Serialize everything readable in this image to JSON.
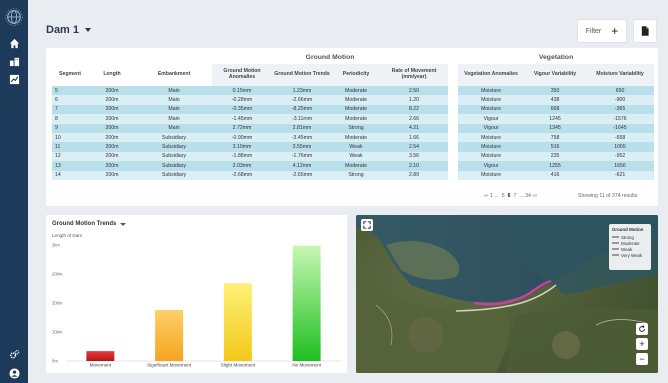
{
  "page": {
    "title": "Dam 1"
  },
  "toolbar": {
    "filter_label": "Filter",
    "plus": "+"
  },
  "table": {
    "group_headers": [
      "Ground Motion",
      "Vegetation"
    ],
    "columns": [
      "Segment",
      "Length",
      "Embankment",
      "Ground Motion Anomalies",
      "Ground Motion Trends",
      "Periodicity",
      "Rate of Movement (mm/year)",
      "Vegetation Anomalies",
      "Vigour Variability",
      "Moisture Variability"
    ],
    "rows": [
      [
        "5",
        "200m",
        "Main",
        "0.15mm",
        "1.23mm",
        "Moderate",
        "2.50",
        "Moisture",
        "350",
        "650"
      ],
      [
        "6",
        "200m",
        "Main",
        "-0.28mm",
        "-2.66mm",
        "Moderate",
        "1.20",
        "Moisture",
        "438",
        "-900"
      ],
      [
        "7",
        "200m",
        "Main",
        "-0.35mm",
        "-8.25mm",
        "Moderate",
        "8.22",
        "Moisture",
        "668",
        "-365"
      ],
      [
        "8",
        "200m",
        "Main",
        "-1.45mm",
        "-3.11mm",
        "Moderate",
        "2.66",
        "Vigour",
        "1245",
        "-1576"
      ],
      [
        "9",
        "200m",
        "Main",
        "2.72mm",
        "2.81mm",
        "Strong",
        "4.21",
        "Vigour",
        "1345",
        "-1645"
      ],
      [
        "10",
        "200m",
        "Subsidiary",
        "-0.90mm",
        "-3.45mm",
        "Moderate",
        "1.66",
        "Moisture",
        "758",
        "-658"
      ],
      [
        "11",
        "200m",
        "Subsidiary",
        "3.10mm",
        "3.55mm",
        "Weak",
        "2.54",
        "Moisture",
        "516",
        "1065"
      ],
      [
        "12",
        "200m",
        "Subsidiary",
        "-1.88mm",
        "-1.76mm",
        "Weak",
        "3.56",
        "Moisture",
        "235",
        "-952"
      ],
      [
        "13",
        "200m",
        "Subsidiary",
        "2.03mm",
        "4.12mm",
        "Moderate",
        "2.10",
        "Vigour",
        "1255",
        "1656"
      ],
      [
        "14",
        "200m",
        "Subsidiary",
        "-2.68mm",
        "-2.65mm",
        "Strong",
        "2.89",
        "Moisture",
        "416",
        "-621"
      ]
    ]
  },
  "pagination": {
    "arrows_left": "«‹ 1 ...",
    "pages": [
      "5",
      "6",
      "7"
    ],
    "current": "6",
    "arrows_right": "... 34 ›»",
    "results": "Showing 11 of 374 results"
  },
  "chart_data": {
    "type": "bar",
    "title": "Ground Motion Trends",
    "ylabel": "Length of Dam",
    "yticks": [
      "2km",
      "200m",
      "200m",
      "100m",
      "0m"
    ],
    "ytick_values": [
      200,
      150,
      100,
      50,
      0
    ],
    "categories": [
      "Movement",
      "Significant Movement",
      "Slight Movement",
      "No Movement"
    ],
    "values": [
      17,
      88,
      134,
      199
    ],
    "ylim": [
      0,
      200
    ],
    "colors": [
      [
        "#e83a3a",
        "#b51616"
      ],
      [
        "#ffcf6a",
        "#f5a51f"
      ],
      [
        "#fff176",
        "#f2c71a"
      ],
      [
        "#c8f7b4",
        "#1fbf1f"
      ]
    ],
    "grid": false
  },
  "map": {
    "legend_title": "Ground Motion",
    "legend_items": [
      {
        "label": "Strong",
        "color": "#d63ab0"
      },
      {
        "label": "Moderate",
        "color": "#e986cc"
      },
      {
        "label": "Weak",
        "color": "#f3c2e6"
      },
      {
        "label": "Very Weak",
        "color": "#ffffff"
      }
    ],
    "zoom_in": "+",
    "zoom_out": "−"
  },
  "colors": {
    "sidebar": "#1e3a5a",
    "row_odd": "#b9dfea",
    "row_even": "#d9eff5",
    "dam_line": "#d63ab0"
  }
}
